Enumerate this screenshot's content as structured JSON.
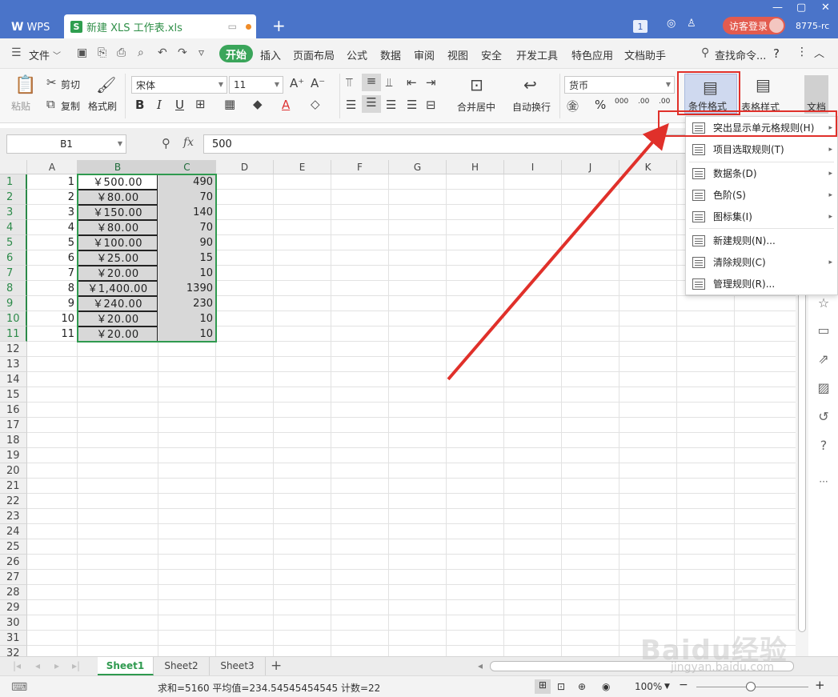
{
  "app": {
    "home_tab": "WPS",
    "doc_tab": "新建 XLS 工作表.xls",
    "new_tab_symbol": "+",
    "badge_count": "1",
    "login_button": "访客登录",
    "account_short": "8775-rc"
  },
  "menubar": {
    "file": "文件",
    "items": [
      "开始",
      "插入",
      "页面布局",
      "公式",
      "数据",
      "审阅",
      "视图",
      "安全",
      "开发工具",
      "特色应用",
      "文档助手"
    ],
    "active_index": 0,
    "search": "查找命令...",
    "help": "?"
  },
  "ribbon": {
    "paste": "粘贴",
    "cut": "剪切",
    "copy": "复制",
    "format_painter": "格式刷",
    "font_name": "宋体",
    "font_size": "11",
    "bold": "B",
    "italic": "I",
    "underline": "U",
    "merge_center": "合并居中",
    "wrap_text": "自动换行",
    "number_format": "货币",
    "percent": "%",
    "thousands": "000",
    "inc_decimal": ".00",
    "dec_decimal": ".00",
    "conditional_format": "条件格式",
    "table_style": "表格样式",
    "document": "文档"
  },
  "formula_bar": {
    "name_box": "B1",
    "fx": "fx",
    "value": "500"
  },
  "columns": [
    "A",
    "B",
    "C",
    "D",
    "E",
    "F",
    "G",
    "H",
    "I",
    "J",
    "K"
  ],
  "row_numbers": [
    "1",
    "2",
    "3",
    "4",
    "5",
    "6",
    "7",
    "8",
    "9",
    "10",
    "11",
    "12",
    "13",
    "14",
    "15",
    "16",
    "17",
    "18",
    "19",
    "20",
    "21",
    "22",
    "23",
    "24",
    "25",
    "26",
    "27",
    "28",
    "29",
    "30",
    "31",
    "32"
  ],
  "rows": [
    {
      "a": "1",
      "b": "￥500.00",
      "c": "490"
    },
    {
      "a": "2",
      "b": "￥80.00",
      "c": "70"
    },
    {
      "a": "3",
      "b": "￥150.00",
      "c": "140"
    },
    {
      "a": "4",
      "b": "￥80.00",
      "c": "70"
    },
    {
      "a": "5",
      "b": "￥100.00",
      "c": "90"
    },
    {
      "a": "6",
      "b": "￥25.00",
      "c": "15"
    },
    {
      "a": "7",
      "b": "￥20.00",
      "c": "10"
    },
    {
      "a": "8",
      "b": "￥1,400.00",
      "c": "1390"
    },
    {
      "a": "9",
      "b": "￥240.00",
      "c": "230"
    },
    {
      "a": "10",
      "b": "￥20.00",
      "c": "10"
    },
    {
      "a": "11",
      "b": "￥20.00",
      "c": "10"
    }
  ],
  "cf_menu": {
    "items": [
      {
        "label": "突出显示单元格规则(H)",
        "submenu": true
      },
      {
        "label": "项目选取规则(T)",
        "submenu": true
      },
      {
        "label": "数据条(D)",
        "submenu": true
      },
      {
        "label": "色阶(S)",
        "submenu": true
      },
      {
        "label": "图标集(I)",
        "submenu": true
      },
      {
        "label": "新建规则(N)...",
        "submenu": false
      },
      {
        "label": "清除规则(C)",
        "submenu": true
      },
      {
        "label": "管理规则(R)...",
        "submenu": false
      }
    ]
  },
  "sheets": [
    "Sheet1",
    "Sheet2",
    "Sheet3"
  ],
  "active_sheet": 0,
  "status": {
    "summary": "求和=5160  平均值=234.54545454545  计数=22",
    "zoom": "100%"
  },
  "watermark": {
    "text": "Baidu经验",
    "url": "jingyan.baidu.com"
  },
  "colors": {
    "titlebar": "#4a74c9",
    "accent_green": "#3aa55a",
    "highlight_red": "#e0302a"
  }
}
